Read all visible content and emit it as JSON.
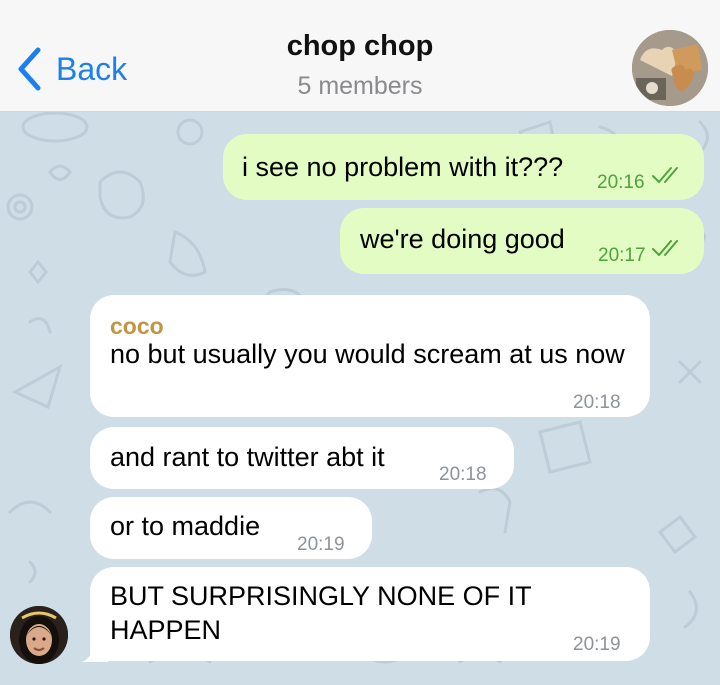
{
  "header": {
    "back_label": "Back",
    "title": "chop chop",
    "subtitle": "5 members",
    "accent": "#1a7ff0"
  },
  "messages": [
    {
      "direction": "outgoing",
      "text": "i see no problem with it???",
      "time": "20:16",
      "status": "read"
    },
    {
      "direction": "outgoing",
      "text": "we're doing good",
      "time": "20:17",
      "status": "read"
    },
    {
      "direction": "incoming",
      "sender": "coco",
      "text": "no but usually you would scream at us now",
      "time": "20:18"
    },
    {
      "direction": "incoming",
      "text": "and rant to twitter abt it",
      "time": "20:18"
    },
    {
      "direction": "incoming",
      "text": "or to maddie",
      "time": "20:19"
    },
    {
      "direction": "incoming",
      "text": "BUT SURPRISINGLY NONE OF IT HAPPEN",
      "time": "20:19"
    }
  ],
  "colors": {
    "outgoing_bubble": "#e3fcc4",
    "incoming_bubble": "#ffffff",
    "sender_name": "#c29542",
    "chat_background": "#cfdde6",
    "read_ticks": "#4da43a"
  }
}
